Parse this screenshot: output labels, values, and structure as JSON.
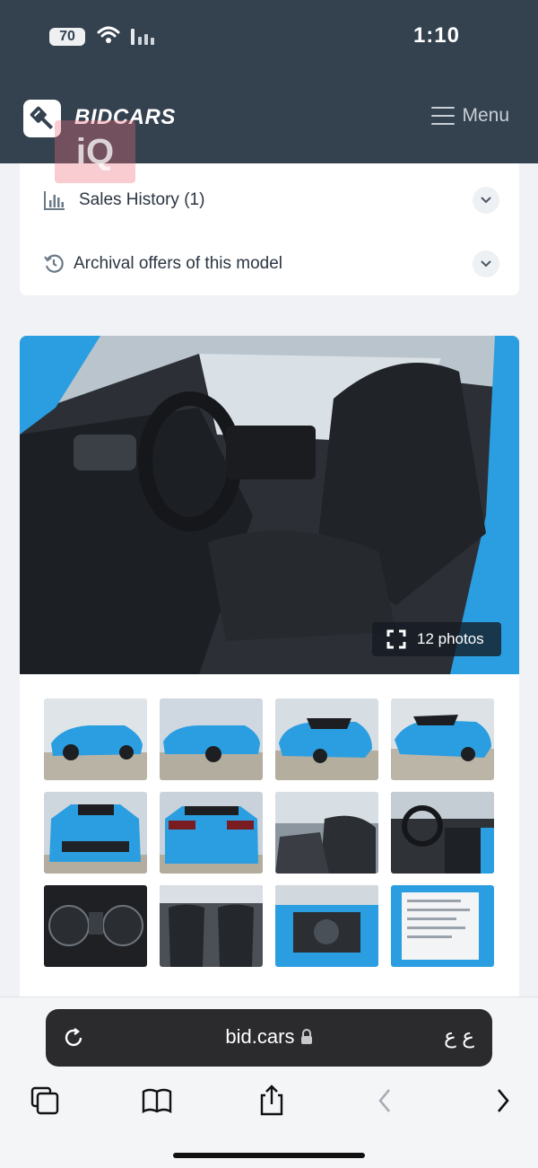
{
  "status": {
    "battery": "70",
    "time": "1:10"
  },
  "header": {
    "brand": "BIDCARS",
    "menu_label": "Menu",
    "watermark": "iQ"
  },
  "accordion": [
    {
      "label": "Sales History (1)",
      "icon": "bar-chart-icon"
    },
    {
      "label": "Archival offers of this model",
      "icon": "history-icon"
    }
  ],
  "gallery": {
    "photos_count_label": "12 photos"
  },
  "browser": {
    "url": "bid.cars",
    "text_size_label": "ع ع"
  },
  "colors": {
    "header_bg": "#34414f",
    "car_blue": "#2a9ee0",
    "page_bg": "#f0f2f5"
  }
}
